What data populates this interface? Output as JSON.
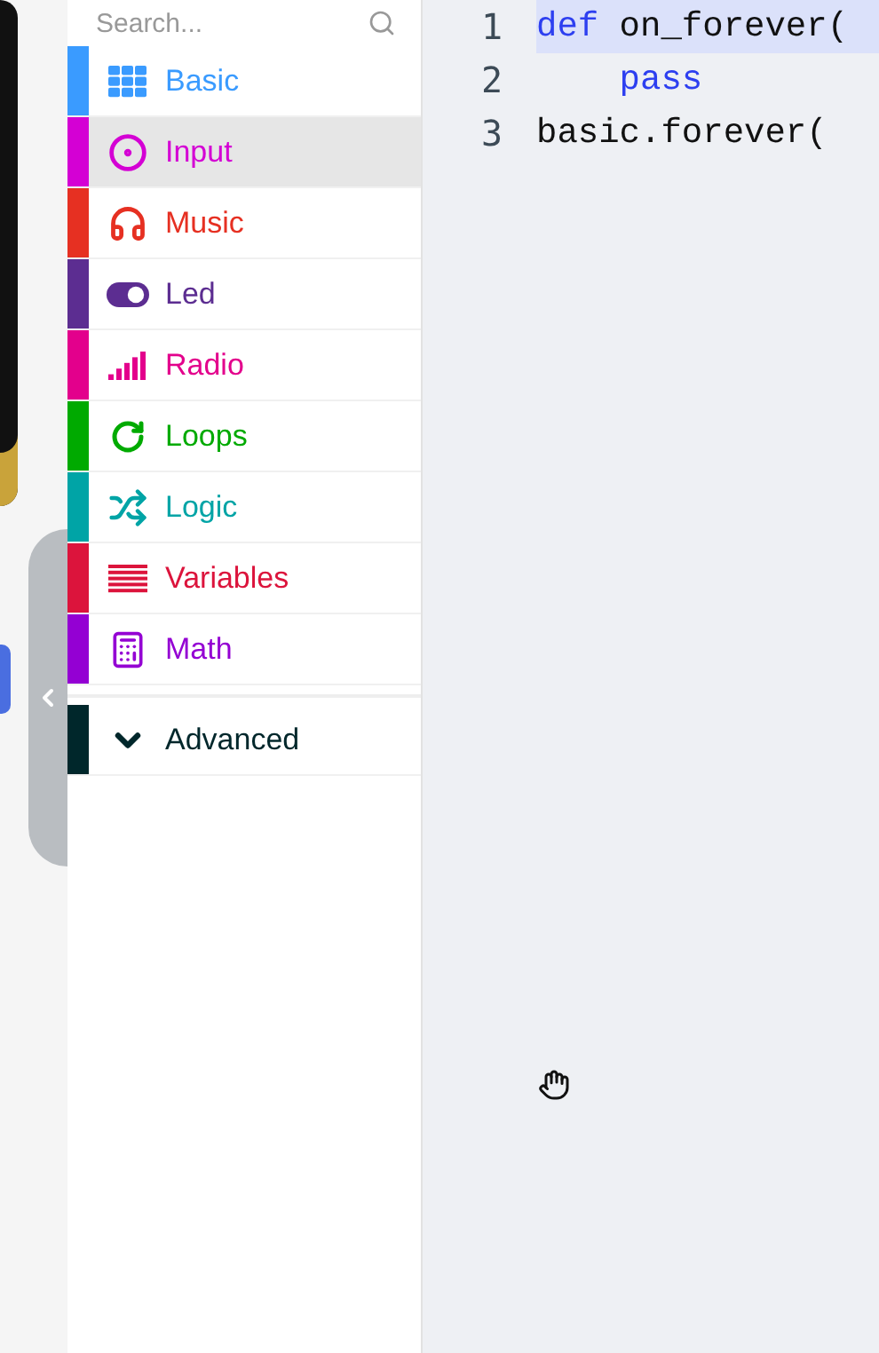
{
  "search": {
    "placeholder": "Search..."
  },
  "categories": [
    {
      "label": "Basic",
      "color": "#3a9bff",
      "selected": false
    },
    {
      "label": "Input",
      "color": "#d400d4",
      "selected": true
    },
    {
      "label": "Music",
      "color": "#e63022",
      "selected": false
    },
    {
      "label": "Led",
      "color": "#5c2d91",
      "selected": false
    },
    {
      "label": "Radio",
      "color": "#e3008c",
      "selected": false
    },
    {
      "label": "Loops",
      "color": "#00aa00",
      "selected": false
    },
    {
      "label": "Logic",
      "color": "#00a4a6",
      "selected": false
    },
    {
      "label": "Variables",
      "color": "#dc143c",
      "selected": false
    },
    {
      "label": "Math",
      "color": "#9400d3",
      "selected": false
    }
  ],
  "advanced": {
    "label": "Advanced",
    "color": "#00272b",
    "expanded": false
  },
  "code_lines": [
    {
      "number": "1",
      "highlighted": true,
      "tokens": [
        {
          "text": "def",
          "kind": "keyword"
        },
        {
          "text": " on_forever(",
          "kind": "plain"
        }
      ]
    },
    {
      "number": "2",
      "highlighted": false,
      "tokens": [
        {
          "text": "    pass",
          "kind": "keyword"
        }
      ]
    },
    {
      "number": "3",
      "highlighted": false,
      "tokens": [
        {
          "text": "basic.forever(",
          "kind": "plain"
        }
      ]
    }
  ]
}
